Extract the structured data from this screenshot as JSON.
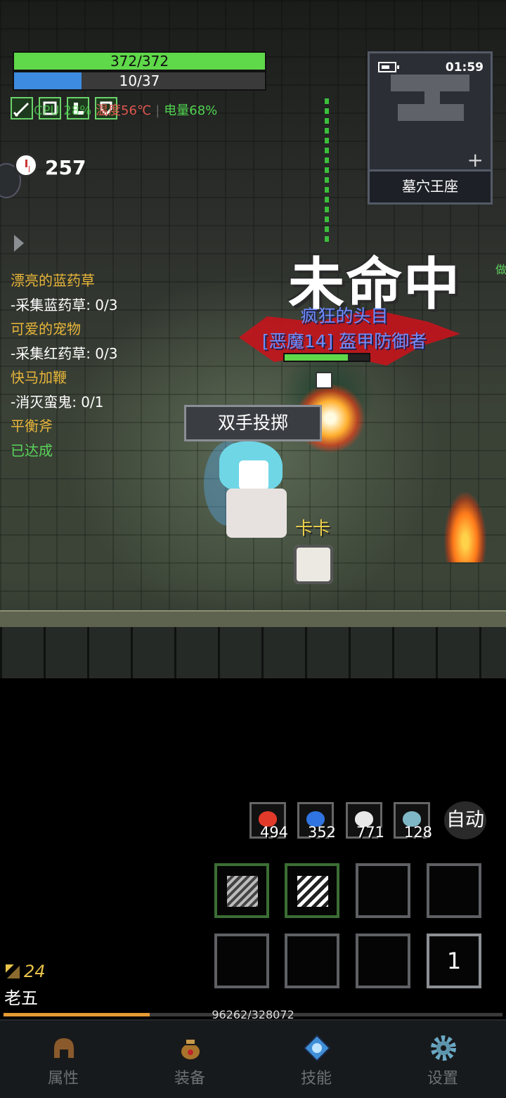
{
  "hud": {
    "hp_text": "372/372",
    "hp": 1.0,
    "mp_text": "10/37",
    "mp": 0.27,
    "cpu_text": "CPU 28%",
    "temp_text": "温度56℃",
    "separator": "|",
    "battery_text": "电量68%",
    "timer": "257"
  },
  "quests": [
    {
      "title": "漂亮的蓝药草",
      "step": "-采集蓝药草: 0/3"
    },
    {
      "title": "可爱的宠物",
      "step": "-采集红药草: 0/3"
    },
    {
      "title": "快马加鞭",
      "step": "-消灭蛮鬼: 0/1"
    },
    {
      "title": "平衡斧",
      "step": "已达成"
    }
  ],
  "minimap": {
    "time": "01:59",
    "location": "墓穴王座",
    "plus": "+"
  },
  "combat": {
    "miss_text": "未命中",
    "side_text": "做",
    "enemy_title": "疯狂的头目",
    "enemy_name": "[恶魔14] 盔甲防御者",
    "enemy_hp": 0.75,
    "skill_popup": "双手投掷",
    "pet_name": "卡卡"
  },
  "consumables": [
    {
      "icon": "red-meat-icon",
      "count": "494",
      "color": "#e23a2a"
    },
    {
      "icon": "blue-potion-icon",
      "count": "352",
      "color": "#2f74e0"
    },
    {
      "icon": "white-potion-icon",
      "count": "771",
      "color": "#e8e8e8"
    },
    {
      "icon": "fish-icon",
      "count": "128",
      "color": "#7fb7c6"
    }
  ],
  "auto_label": "自动",
  "slots": {
    "count_slot": "1"
  },
  "player": {
    "level": "24",
    "name": "老五",
    "xp_text": "96262/328072",
    "xp": 0.293
  },
  "nav": [
    {
      "label": "属性",
      "icon": "helmet-icon"
    },
    {
      "label": "装备",
      "icon": "bag-icon"
    },
    {
      "label": "技能",
      "icon": "skill-gem-icon"
    },
    {
      "label": "设置",
      "icon": "gear-icon"
    }
  ],
  "colors": {
    "hp": "#5fd84a",
    "mp": "#3d8be0",
    "quest_title": "#e8b63a",
    "quest_done": "#59d459",
    "xp": "#e59b35"
  }
}
